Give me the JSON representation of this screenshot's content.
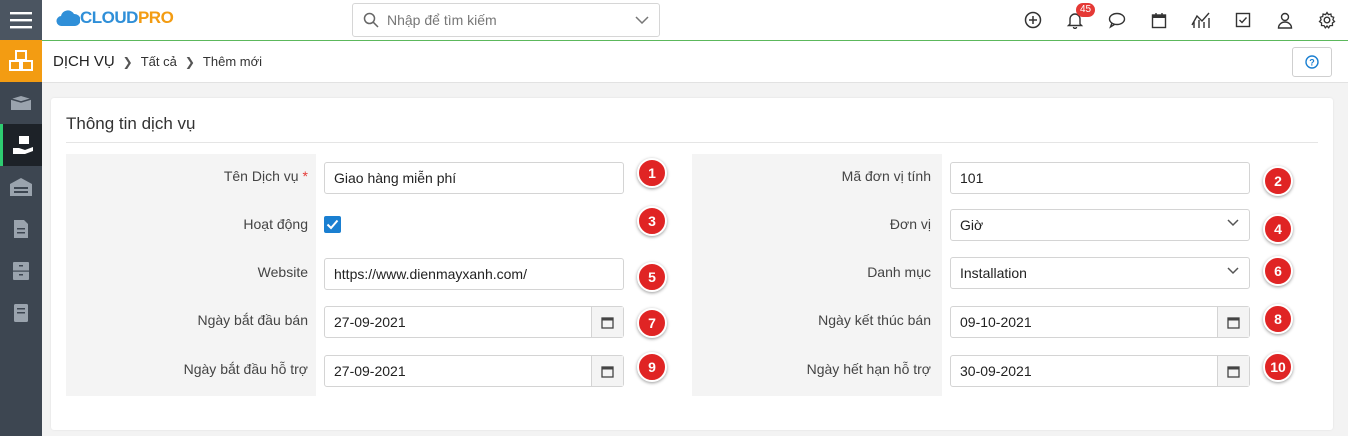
{
  "app": {
    "logo_main": "CLOUD",
    "logo_accent": "PRO"
  },
  "search": {
    "placeholder": "Nhập để tìm kiếm"
  },
  "topbar": {
    "notification_count": "45"
  },
  "breadcrumb": {
    "module": "DỊCH VỤ",
    "level1": "Tất cả",
    "level2": "Thêm mới"
  },
  "card": {
    "title": "Thông tin dịch vụ"
  },
  "form": {
    "service_name": {
      "label": "Tên Dịch vụ",
      "required": "*",
      "value": "Giao hàng miễn phí",
      "marker": "1"
    },
    "unit_code": {
      "label": "Mã đơn vị tính",
      "value": "101",
      "marker": "2"
    },
    "active": {
      "label": "Hoạt động",
      "checked": true,
      "marker": "3"
    },
    "unit": {
      "label": "Đơn vị",
      "value": "Giờ",
      "marker": "4"
    },
    "website": {
      "label": "Website",
      "value": "https://www.dienmayxanh.com/",
      "marker": "5"
    },
    "category": {
      "label": "Danh mục",
      "value": "Installation",
      "marker": "6"
    },
    "sale_start": {
      "label": "Ngày bắt đầu bán",
      "value": "27-09-2021",
      "marker": "7"
    },
    "sale_end": {
      "label": "Ngày kết thúc bán",
      "value": "09-10-2021",
      "marker": "8"
    },
    "support_start": {
      "label": "Ngày bắt đầu hỗ trợ",
      "value": "27-09-2021",
      "marker": "9"
    },
    "support_end": {
      "label": "Ngày hết hạn hỗ trợ",
      "value": "30-09-2021",
      "marker": "10"
    }
  },
  "colors": {
    "sidebar": "#3d4651",
    "accent_orange": "#f39c12",
    "brand_blue": "#2f8fd8",
    "marker_red": "#e02424"
  }
}
